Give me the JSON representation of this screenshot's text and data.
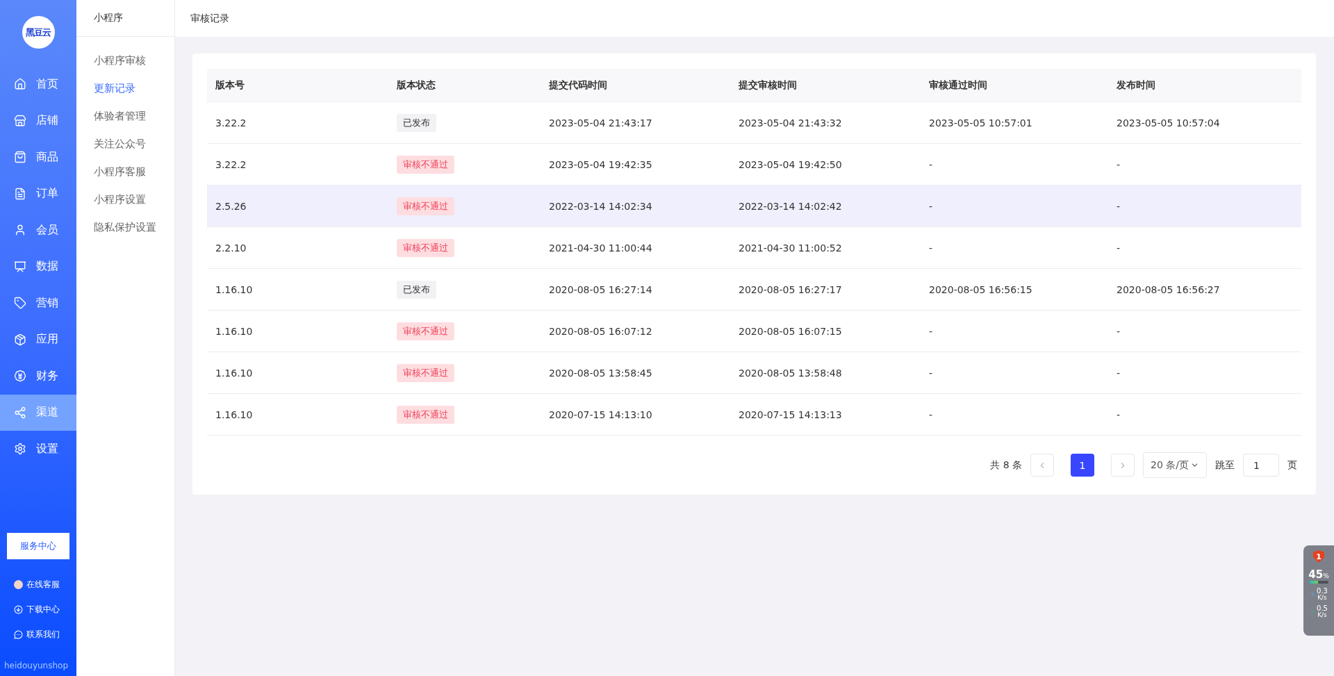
{
  "sidebar": {
    "logo": "黑豆云",
    "items": [
      {
        "label": "首页",
        "selected": false
      },
      {
        "label": "店铺",
        "selected": false
      },
      {
        "label": "商品",
        "selected": false
      },
      {
        "label": "订单",
        "selected": false
      },
      {
        "label": "会员",
        "selected": false
      },
      {
        "label": "数据",
        "selected": false
      },
      {
        "label": "营销",
        "selected": false
      },
      {
        "label": "应用",
        "selected": false
      },
      {
        "label": "财务",
        "selected": false
      },
      {
        "label": "渠道",
        "selected": true
      },
      {
        "label": "设置",
        "selected": false
      }
    ],
    "service_button": "服务中心",
    "links": [
      {
        "kind": "avatar",
        "label": "在线客服"
      },
      {
        "kind": "download",
        "label": "下载中心"
      },
      {
        "kind": "chat",
        "label": "联系我们"
      }
    ],
    "brand": "heidouyunshop"
  },
  "submenu": {
    "title": "小程序",
    "items": [
      {
        "label": "小程序审核",
        "selected": false
      },
      {
        "label": "更新记录",
        "selected": true
      },
      {
        "label": "体验者管理",
        "selected": false
      },
      {
        "label": "关注公众号",
        "selected": false
      },
      {
        "label": "小程序客服",
        "selected": false
      },
      {
        "label": "小程序设置",
        "selected": false
      },
      {
        "label": "隐私保护设置",
        "selected": false
      }
    ]
  },
  "header": {
    "title": "审核记录"
  },
  "table": {
    "columns": [
      "版本号",
      "版本状态",
      "提交代码时间",
      "提交审核时间",
      "审核通过时间",
      "发布时间"
    ],
    "rows": [
      {
        "version": "3.22.2",
        "status": {
          "kind": "published",
          "label": "已发布"
        },
        "code_time": "2023-05-04 21:43:17",
        "audit_time": "2023-05-04 21:43:32",
        "pass_time": "2023-05-05 10:57:01",
        "publish_time": "2023-05-05 10:57:04",
        "highlighted": false
      },
      {
        "version": "3.22.2",
        "status": {
          "kind": "rejected",
          "label": "审核不通过"
        },
        "code_time": "2023-05-04 19:42:35",
        "audit_time": "2023-05-04 19:42:50",
        "pass_time": "-",
        "publish_time": "-",
        "highlighted": false
      },
      {
        "version": "2.5.26",
        "status": {
          "kind": "rejected",
          "label": "审核不通过"
        },
        "code_time": "2022-03-14 14:02:34",
        "audit_time": "2022-03-14 14:02:42",
        "pass_time": "-",
        "publish_time": "-",
        "highlighted": true
      },
      {
        "version": "2.2.10",
        "status": {
          "kind": "rejected",
          "label": "审核不通过"
        },
        "code_time": "2021-04-30 11:00:44",
        "audit_time": "2021-04-30 11:00:52",
        "pass_time": "-",
        "publish_time": "-",
        "highlighted": false
      },
      {
        "version": "1.16.10",
        "status": {
          "kind": "published",
          "label": "已发布"
        },
        "code_time": "2020-08-05 16:27:14",
        "audit_time": "2020-08-05 16:27:17",
        "pass_time": "2020-08-05 16:56:15",
        "publish_time": "2020-08-05 16:56:27",
        "highlighted": false
      },
      {
        "version": "1.16.10",
        "status": {
          "kind": "rejected",
          "label": "审核不通过"
        },
        "code_time": "2020-08-05 16:07:12",
        "audit_time": "2020-08-05 16:07:15",
        "pass_time": "-",
        "publish_time": "-",
        "highlighted": false
      },
      {
        "version": "1.16.10",
        "status": {
          "kind": "rejected",
          "label": "审核不通过"
        },
        "code_time": "2020-08-05 13:58:45",
        "audit_time": "2020-08-05 13:58:48",
        "pass_time": "-",
        "publish_time": "-",
        "highlighted": false
      },
      {
        "version": "1.16.10",
        "status": {
          "kind": "rejected",
          "label": "审核不通过"
        },
        "code_time": "2020-07-15 14:13:10",
        "audit_time": "2020-07-15 14:13:13",
        "pass_time": "-",
        "publish_time": "-",
        "highlighted": false
      }
    ]
  },
  "pagination": {
    "total": "共 8 条",
    "pages": [
      {
        "label": "1",
        "selected": true
      }
    ],
    "page_size": "20 条/页",
    "jump_label": "跳至",
    "jump_value": "1",
    "page_unit": "页"
  },
  "monitor": {
    "badge": "1",
    "percent": "45",
    "percent_unit": "%",
    "level": 0.45,
    "upload": "0.3",
    "upload_unit": "K/s",
    "download": "0.5",
    "download_unit": "K/s"
  }
}
